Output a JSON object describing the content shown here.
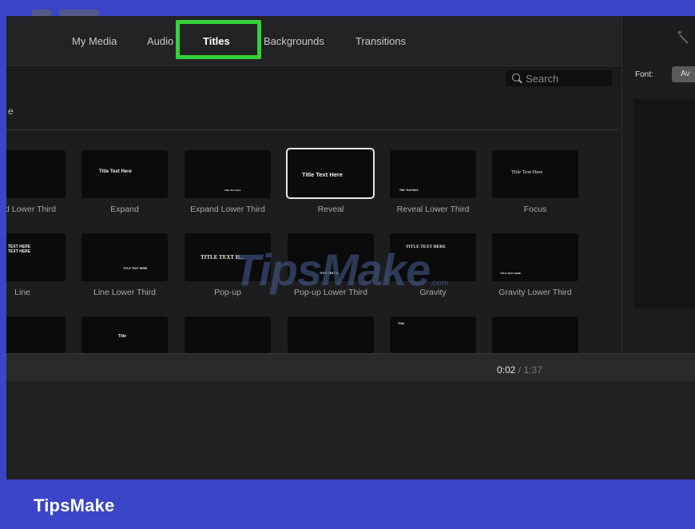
{
  "tabs": [
    {
      "label": "My Media"
    },
    {
      "label": "Audio"
    },
    {
      "label": "Titles",
      "active": true
    },
    {
      "label": "Backgrounds"
    },
    {
      "label": "Transitions"
    }
  ],
  "search": {
    "placeholder": "Search"
  },
  "section": {
    "label": "e"
  },
  "titles": {
    "row1": [
      {
        "caption": "ard Lower Third",
        "thumb_text": ""
      },
      {
        "caption": "Expand",
        "thumb_text": "Title Text Here"
      },
      {
        "caption": "Expand Lower Third",
        "thumb_text": "Title Text Here"
      },
      {
        "caption": "Reveal",
        "thumb_text": "Title Text Here",
        "selected": true
      },
      {
        "caption": "Reveal Lower Third",
        "thumb_text": "Title Text Here"
      },
      {
        "caption": "Focus",
        "thumb_text": "Title Text Here"
      }
    ],
    "row2": [
      {
        "caption": "Line",
        "thumb_text": "TEXT HERE TEXT HERE"
      },
      {
        "caption": "Line Lower Third",
        "thumb_text": "TITLE TEXT HERE"
      },
      {
        "caption": "Pop-up",
        "thumb_text": "TITLE TEXT H..."
      },
      {
        "caption": "Pop-up Lower Third",
        "thumb_text": "TITLE TEXT H..."
      },
      {
        "caption": "Gravity",
        "thumb_text": "TITLE TEXT HERE"
      },
      {
        "caption": "Gravity Lower Third",
        "thumb_text": "TITLE TEXT HERE"
      }
    ],
    "row3": [
      {
        "thumb_text": ""
      },
      {
        "thumb_text": "Title"
      },
      {
        "thumb_text": ""
      },
      {
        "thumb_text": ""
      },
      {
        "thumb_text": "Title"
      },
      {
        "thumb_text": ""
      }
    ]
  },
  "inspector": {
    "font_label": "Font:",
    "font_value": "Av"
  },
  "timeline": {
    "current": "0:02",
    "separator": "/",
    "total": "1:37"
  },
  "brand": "TipsMake",
  "watermark": {
    "text": "TipsMake",
    "suffix": ".com"
  },
  "colors": {
    "highlight": "#34d13b",
    "frame": "#3b45c8",
    "app_bg": "#1d1d1f"
  },
  "icons": [
    "search-icon",
    "magic-wand-icon"
  ]
}
